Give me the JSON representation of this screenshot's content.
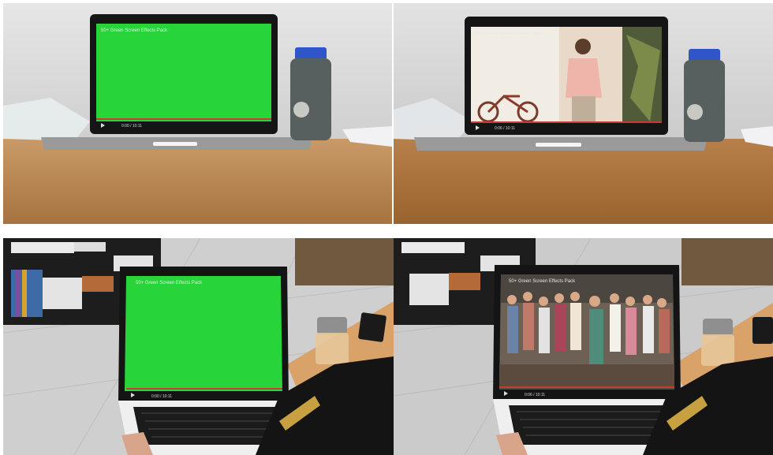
{
  "panels": [
    {
      "screen": "green",
      "video_title": "50+ Green Screen Effects Pack",
      "time": "0:00 / 10:11"
    },
    {
      "screen": "video",
      "video_title": "50+ Green Screen Effects Pack",
      "time": "0:06 / 10:11"
    },
    {
      "screen": "green",
      "video_title": "50+ Green Screen Effects Pack",
      "time": "0:00 / 10:11"
    },
    {
      "screen": "video",
      "video_title": "50+ Green Screen Effects Pack",
      "time": "0:06 / 10:11"
    }
  ],
  "colors": {
    "green_screen": "#27d53a",
    "desk": "#b98450",
    "bottle_cap": "#2f55c9",
    "wall": "#dcdcdc"
  }
}
